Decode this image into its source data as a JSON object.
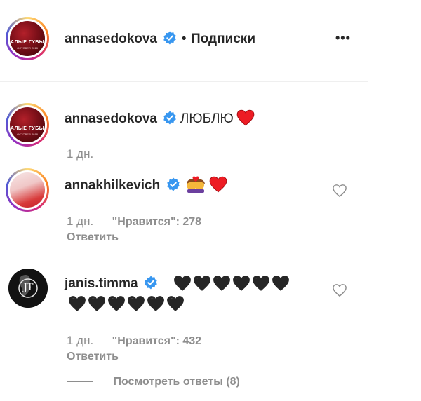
{
  "header": {
    "username": "annasedokova",
    "separator": "•",
    "follow_status": "Подписки",
    "more_label": "•••",
    "avatar_text_1": "АЛЫЕ ГУБЫ",
    "avatar_text_2": "OCTOBER 2018"
  },
  "caption": {
    "username": "annasedokova",
    "text": "ЛЮБЛЮ",
    "time": "1 дн."
  },
  "comments": [
    {
      "username": "annakhilkevich",
      "time": "1 дн.",
      "likes": "\"Нравится\": 278",
      "reply_label": "Ответить"
    },
    {
      "username": "janis.timma",
      "time": "1 дн.",
      "likes": "\"Нравится\": 432",
      "reply_label": "Ответить",
      "avatar_initials": "JT",
      "view_replies": "Посмотреть ответы (8)"
    }
  ],
  "colors": {
    "verified_blue": "#3897f0",
    "red_heart": "#ed1c24",
    "black_heart": "#262626"
  }
}
